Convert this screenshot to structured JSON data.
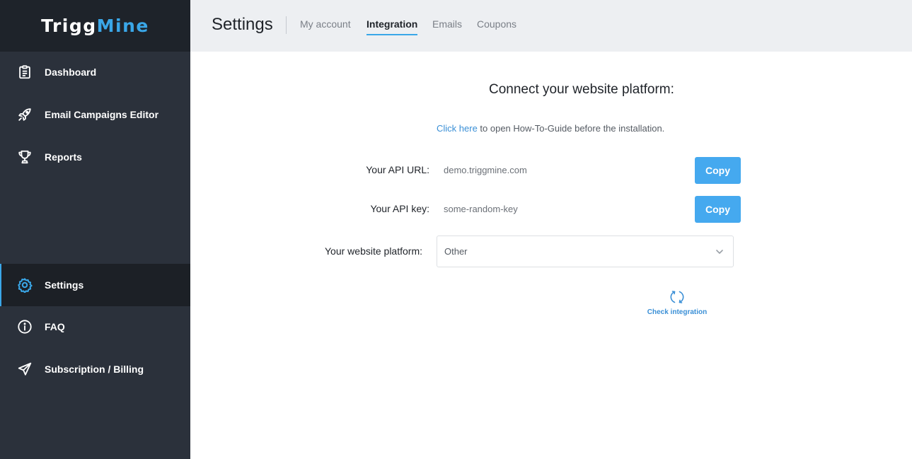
{
  "brand": {
    "part1": "Trigg",
    "part2": "Mine",
    "accent": "#3aa7e8"
  },
  "sidebar": {
    "items": [
      {
        "label": "Dashboard",
        "icon": "clipboard-icon"
      },
      {
        "label": "Email Campaigns Editor",
        "icon": "rocket-icon"
      },
      {
        "label": "Reports",
        "icon": "trophy-icon"
      },
      {
        "label": "Settings",
        "icon": "gear-icon",
        "active": true
      },
      {
        "label": "FAQ",
        "icon": "info-icon"
      },
      {
        "label": "Subscription / Billing",
        "icon": "paper-plane-icon"
      }
    ]
  },
  "header": {
    "title": "Settings",
    "tabs": [
      {
        "label": "My account"
      },
      {
        "label": "Integration",
        "active": true
      },
      {
        "label": "Emails"
      },
      {
        "label": "Coupons"
      }
    ]
  },
  "main": {
    "title": "Connect your website platform:",
    "guide_link": "Click here",
    "guide_text": " to open How-To-Guide before the installation.",
    "api_url_label": "Your API URL:",
    "api_url_value": "demo.triggmine.com",
    "api_key_label": "Your API key:",
    "api_key_value": "some-random-key",
    "copy_label": "Copy",
    "platform_label": "Your website platform:",
    "platform_value": "Other",
    "check_label": "Check integration"
  }
}
